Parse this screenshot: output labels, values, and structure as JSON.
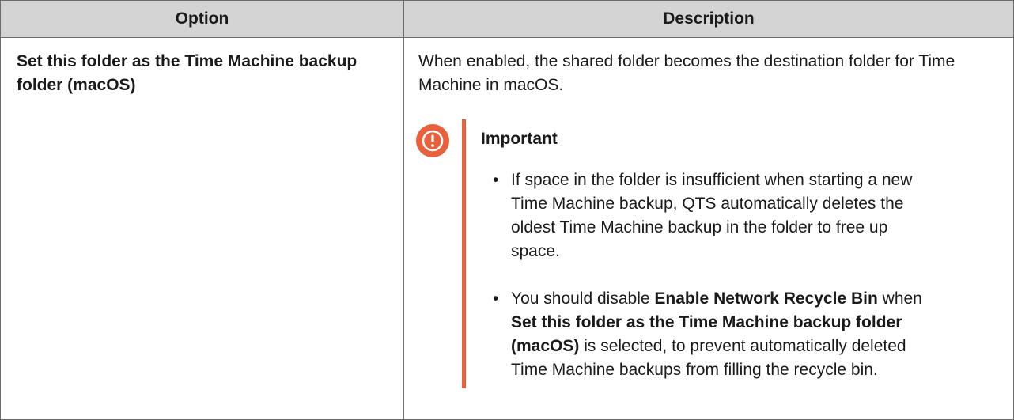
{
  "table": {
    "headers": {
      "option": "Option",
      "description": "Description"
    },
    "rows": [
      {
        "option": "Set this folder as the Time Machine backup folder (macOS)",
        "description": "When enabled, the shared folder becomes the destination folder for Time Machine in macOS.",
        "important": {
          "title": "Important",
          "icon": "exclamation-circle-icon",
          "accent_color": "#e8603c",
          "items": [
            {
              "bullet": "•",
              "text": "If space in the folder is insufficient when starting a new Time Machine backup, QTS automatically deletes the oldest Time Machine backup in the folder to free up space."
            },
            {
              "bullet": "•",
              "parts": [
                "You should disable ",
                "Enable Network Recycle Bin",
                " when ",
                "Set this folder as the Time Machine backup folder (macOS)",
                " is selected, to prevent automatically deleted Time Machine backups from filling the recycle bin."
              ]
            }
          ]
        }
      }
    ]
  },
  "colors": {
    "header_background": "#d4d4d4",
    "border": "#6b6b6b",
    "accent": "#e8603c"
  }
}
